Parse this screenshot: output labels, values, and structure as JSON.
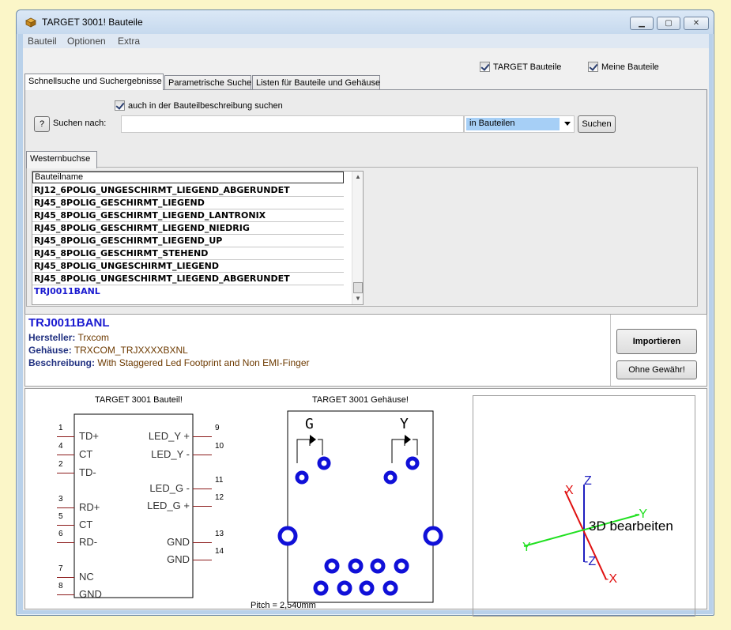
{
  "window": {
    "title": "TARGET 3001! Bauteile"
  },
  "menu": [
    "Bauteil",
    "Optionen",
    "Extra"
  ],
  "filters": {
    "target_parts": "TARGET Bauteile",
    "my_parts": "Meine Bauteile"
  },
  "tabs": [
    "Schnellsuche und Suchergebnisse",
    "Parametrische Suche",
    "Listen für Bauteile und Gehäuse"
  ],
  "search": {
    "desc_checkbox": "auch in der Bauteilbeschreibung suchen",
    "help_label": "?",
    "label": "Suchen nach:",
    "value": "",
    "scope": "in Bauteilen",
    "button": "Suchen"
  },
  "result_tab": "Westernbuchse",
  "list": {
    "header": "Bauteilname",
    "rows": [
      "RJ12_6POLIG_UNGESCHIRMT_LIEGEND_ABGERUNDET",
      "RJ45_8POLIG_GESCHIRMT_LIEGEND",
      "RJ45_8POLIG_GESCHIRMT_LIEGEND_LANTRONIX",
      "RJ45_8POLIG_GESCHIRMT_LIEGEND_NIEDRIG",
      "RJ45_8POLIG_GESCHIRMT_LIEGEND_UP",
      "RJ45_8POLIG_GESCHIRMT_STEHEND",
      "RJ45_8POLIG_UNGESCHIRMT_LIEGEND",
      "RJ45_8POLIG_UNGESCHIRMT_LIEGEND_ABGERUNDET",
      "TRJ0011BANL"
    ]
  },
  "details": {
    "name": "TRJ0011BANL",
    "manufacturer_label": "Hersteller:",
    "manufacturer": "Trxcom",
    "package_label": "Gehäuse:",
    "package": "TRXCOM_TRJXXXXBXNL",
    "description_label": "Beschreibung:",
    "description": "With Staggered Led Footprint and Non EMI-Finger",
    "import_button": "Importieren",
    "no_warranty_button": "Ohne Gewähr!"
  },
  "preview": {
    "symbol_caption": "TARGET 3001 Bauteil!",
    "package_caption": "TARGET 3001 Gehäuse!",
    "pitch": "Pitch = 2,540mm",
    "edit_3d": "3D bearbeiten",
    "left_pins": [
      {
        "num": "1",
        "name": "TD+"
      },
      {
        "num": "4",
        "name": "CT"
      },
      {
        "num": "2",
        "name": "TD-"
      },
      {
        "num": "3",
        "name": "RD+"
      },
      {
        "num": "5",
        "name": "CT"
      },
      {
        "num": "6",
        "name": "RD-"
      },
      {
        "num": "7",
        "name": "NC"
      },
      {
        "num": "8",
        "name": "GND"
      }
    ],
    "right_pins": [
      {
        "num": "9",
        "name": "LED_Y +"
      },
      {
        "num": "10",
        "name": "LED_Y -"
      },
      {
        "num": "11",
        "name": "LED_G -"
      },
      {
        "num": "12",
        "name": "LED_G +"
      },
      {
        "num": "13",
        "name": "GND"
      },
      {
        "num": "14",
        "name": "GND"
      }
    ],
    "led_labels": [
      "G",
      "Y"
    ],
    "axes": {
      "x": "X",
      "neg_x": "-X",
      "y": "Y",
      "neg_y": "-Y",
      "z": "Z",
      "neg_z": "-Z"
    }
  },
  "colors": {
    "accent_blue": "#1a1ad0",
    "pad_blue": "#1010d8",
    "axis_red": "#e01010",
    "axis_green": "#20e020",
    "axis_blue": "#2020c0"
  }
}
